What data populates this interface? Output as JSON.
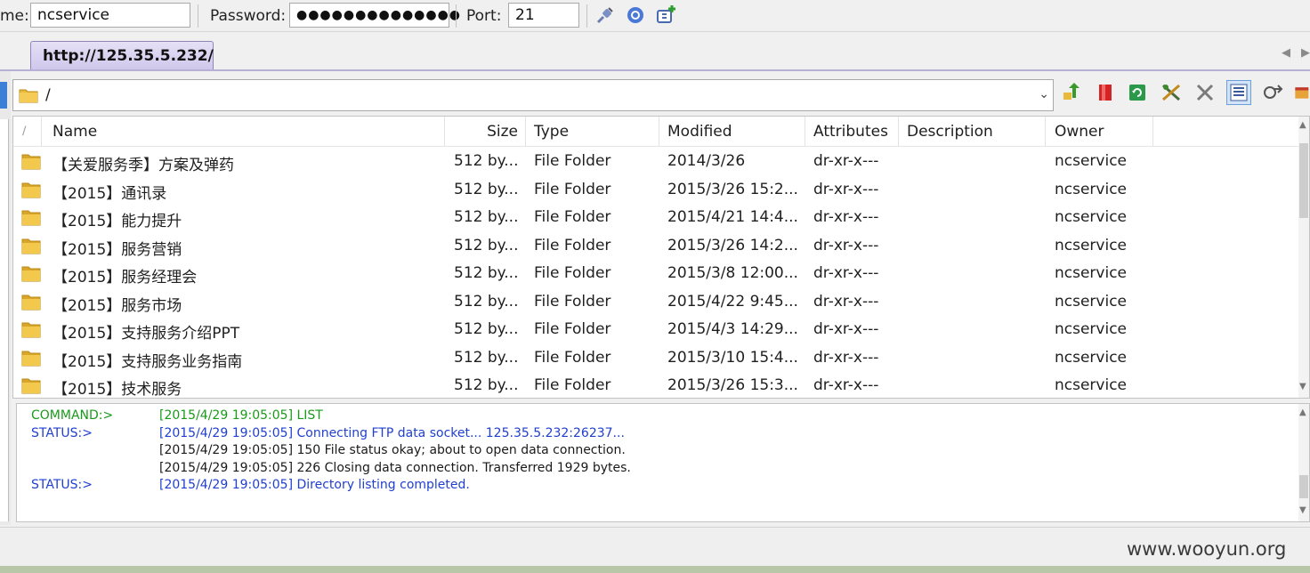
{
  "connection": {
    "name_label": "me:",
    "name_value": "ncservice",
    "password_label": "Password:",
    "password_value": "●●●●●●●●●●●●●●",
    "port_label": "Port:",
    "port_value": "21"
  },
  "tabs": [
    {
      "label": "http://125.35.5.232/"
    }
  ],
  "path": {
    "value": "/"
  },
  "columns": [
    "Name",
    "Size",
    "Type",
    "Modified",
    "Attributes",
    "Description",
    "Owner"
  ],
  "files": [
    {
      "name": "【关爱服务季】方案及弹药",
      "size": "512 by...",
      "type": "File Folder",
      "modified": "2014/3/26",
      "attributes": "dr-xr-x---",
      "description": "",
      "owner": "ncservice"
    },
    {
      "name": "【2015】通讯录",
      "size": "512 by...",
      "type": "File Folder",
      "modified": "2015/3/26 15:2...",
      "attributes": "dr-xr-x---",
      "description": "",
      "owner": "ncservice"
    },
    {
      "name": "【2015】能力提升",
      "size": "512 by...",
      "type": "File Folder",
      "modified": "2015/4/21 14:4...",
      "attributes": "dr-xr-x---",
      "description": "",
      "owner": "ncservice"
    },
    {
      "name": "【2015】服务营销",
      "size": "512 by...",
      "type": "File Folder",
      "modified": "2015/3/26 14:2...",
      "attributes": "dr-xr-x---",
      "description": "",
      "owner": "ncservice"
    },
    {
      "name": "【2015】服务经理会",
      "size": "512 by...",
      "type": "File Folder",
      "modified": "2015/3/8 12:00...",
      "attributes": "dr-xr-x---",
      "description": "",
      "owner": "ncservice"
    },
    {
      "name": "【2015】服务市场",
      "size": "512 by...",
      "type": "File Folder",
      "modified": "2015/4/22 9:45...",
      "attributes": "dr-xr-x---",
      "description": "",
      "owner": "ncservice"
    },
    {
      "name": "【2015】支持服务介绍PPT",
      "size": "512 by...",
      "type": "File Folder",
      "modified": "2015/4/3 14:29...",
      "attributes": "dr-xr-x---",
      "description": "",
      "owner": "ncservice"
    },
    {
      "name": "【2015】支持服务业务指南",
      "size": "512 by...",
      "type": "File Folder",
      "modified": "2015/3/10 15:4...",
      "attributes": "dr-xr-x---",
      "description": "",
      "owner": "ncservice"
    },
    {
      "name": "【2015】技术服务",
      "size": "512 by...",
      "type": "File Folder",
      "modified": "2015/3/26 15:3...",
      "attributes": "dr-xr-x---",
      "description": "",
      "owner": "ncservice"
    }
  ],
  "log": [
    {
      "kind": "COMMAND:>",
      "text": "[2015/4/29 19:05:05] LIST",
      "color": "#1a9a1a"
    },
    {
      "kind": "STATUS:>",
      "text": "[2015/4/29 19:05:05] Connecting FTP data socket... 125.35.5.232:26237...",
      "color": "#1f3fd0"
    },
    {
      "kind": "",
      "text": "[2015/4/29 19:05:05] 150 File status okay; about to open data connection.",
      "color": "#1a1a1a"
    },
    {
      "kind": "",
      "text": "[2015/4/29 19:05:05] 226 Closing data connection. Transferred 1929 bytes.",
      "color": "#1a1a1a"
    },
    {
      "kind": "STATUS:>",
      "text": "[2015/4/29 19:05:05] Directory listing completed.",
      "color": "#1f3fd0"
    }
  ],
  "watermark": "www.wooyun.org",
  "colors": {
    "tab_bg": "#d6cff0",
    "folder": "#e8b93a",
    "command": "#1a9a1a",
    "status": "#1f3fd0"
  }
}
